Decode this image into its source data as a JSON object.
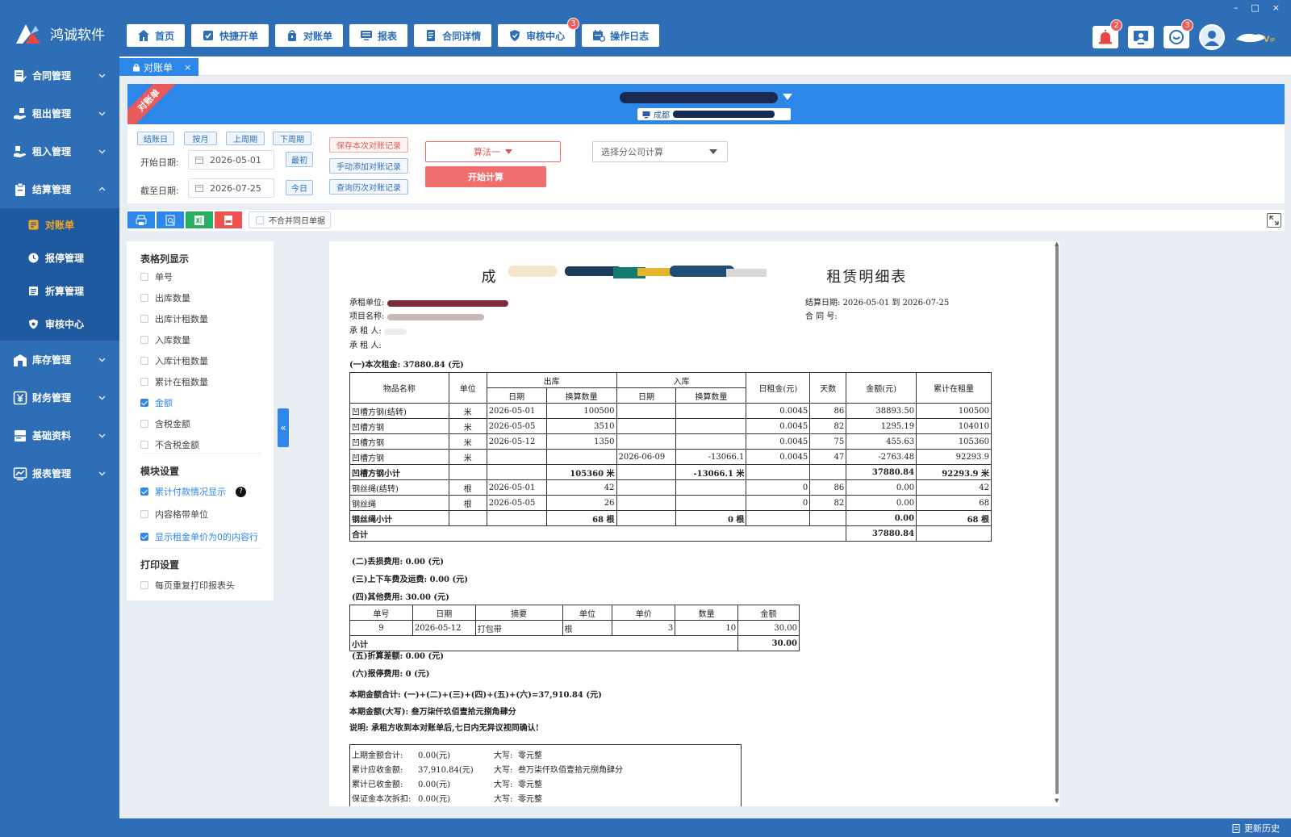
{
  "app": {
    "name": "鸿诚软件",
    "window_controls": [
      "–",
      "□",
      "×"
    ],
    "update_label": "更新历史"
  },
  "nav": [
    {
      "label": "首页",
      "icon": "home-icon"
    },
    {
      "label": "快捷开单",
      "icon": "checkbox-icon"
    },
    {
      "label": "对账单",
      "icon": "bag-icon"
    },
    {
      "label": "报表",
      "icon": "monitor-icon"
    },
    {
      "label": "合同详情",
      "icon": "document-icon"
    },
    {
      "label": "审核中心",
      "icon": "shield-icon",
      "badge": "3"
    },
    {
      "label": "操作日志",
      "icon": "calendar-icon"
    }
  ],
  "header_icons": {
    "alarm_badge": "2",
    "chat_badge": "3"
  },
  "sidebar": {
    "items": [
      {
        "label": "合同管理"
      },
      {
        "label": "租出管理"
      },
      {
        "label": "租入管理"
      },
      {
        "label": "结算管理"
      },
      {
        "label": "库存管理"
      },
      {
        "label": "财务管理"
      },
      {
        "label": "基础资料"
      },
      {
        "label": "报表管理"
      }
    ],
    "sub": [
      {
        "label": "对账单"
      },
      {
        "label": "报停管理"
      },
      {
        "label": "折算管理"
      },
      {
        "label": "审核中心"
      }
    ]
  },
  "tab": {
    "label": "对账单",
    "close": "×"
  },
  "banner": {
    "ribbon": "对账单",
    "sub_prefix": "成都"
  },
  "controls": {
    "quick": [
      "结账日",
      "按月",
      "上周期",
      "下周期"
    ],
    "start_label": "开始日期:",
    "start_date": "2026-05-01",
    "start_btn": "最初",
    "end_label": "截至日期:",
    "end_date": "2026-07-25",
    "end_btn": "今日",
    "save_btn": "保存本次对账记录",
    "add_btn": "手动添加对账记录",
    "query_btn": "查询历次对账记录",
    "algo": "算法一",
    "start_calc": "开始计算",
    "company_placeholder": "选择分公司计算"
  },
  "toolbar": {
    "merge_label": "不合并同日单据",
    "colors": {
      "blue": "#2d87e8",
      "green": "#27ae60",
      "red": "#ef5350"
    }
  },
  "panel": {
    "col_title": "表格列显示",
    "cols": [
      {
        "label": "单号",
        "checked": false
      },
      {
        "label": "出库数量",
        "checked": false
      },
      {
        "label": "出库计租数量",
        "checked": false
      },
      {
        "label": "入库数量",
        "checked": false
      },
      {
        "label": "入库计租数量",
        "checked": false
      },
      {
        "label": "累计在租数量",
        "checked": false
      },
      {
        "label": "金额",
        "checked": true
      },
      {
        "label": "含税金额",
        "checked": false
      },
      {
        "label": "不含税金额",
        "checked": false
      }
    ],
    "module_title": "模块设置",
    "modules": [
      {
        "label": "累计付款情况显示",
        "checked": true
      },
      {
        "label": "内容格带单位",
        "checked": false
      },
      {
        "label": "显示租金单价为0的内容行",
        "checked": true
      }
    ],
    "help": "?",
    "print_title": "打印设置",
    "print": [
      {
        "label": "每页重复打印报表头",
        "checked": false
      }
    ],
    "collapse": "«"
  },
  "report": {
    "title_start": "成",
    "title_end": "租赁明细表",
    "tenant_label": "承租单位:",
    "project_label": "项目名称:",
    "lessee1_label": "承 租 人:",
    "lessee2_label": "承 租 人:",
    "period_label": "结算日期: 2026-05-01 到 2026-07-25",
    "contract_label": "合 同 号:",
    "sec1": "(一)本次租金: 37880.84 (元)",
    "table": {
      "h_item": "物品名称",
      "h_unit": "单位",
      "h_out": "出库",
      "h_in": "入库",
      "h_rent": "日租金(元)",
      "h_days": "天数",
      "h_amount": "金额(元)",
      "h_cum": "累计在租量",
      "h_date": "日期",
      "h_qty": "换算数量",
      "rows": [
        [
          "凹槽方钢(结转)",
          "米",
          "2026-05-01",
          "100500",
          "",
          "",
          "0.0045",
          "86",
          "38893.50",
          "100500"
        ],
        [
          "凹槽方钢",
          "米",
          "2026-05-05",
          "3510",
          "",
          "",
          "0.0045",
          "82",
          "1295.19",
          "104010"
        ],
        [
          "凹槽方钢",
          "米",
          "2026-05-12",
          "1350",
          "",
          "",
          "0.0045",
          "75",
          "455.63",
          "105360"
        ],
        [
          "凹槽方钢",
          "米",
          "",
          "",
          "2026-06-09",
          "-13066.1",
          "0.0045",
          "47",
          "-2763.48",
          "92293.9"
        ],
        [
          "凹槽方钢小计",
          "",
          "",
          "105360 米",
          "",
          "-13066.1 米",
          "",
          "",
          "37880.84",
          "92293.9 米"
        ],
        [
          "钢丝绳(结转)",
          "根",
          "2026-05-01",
          "42",
          "",
          "",
          "0",
          "86",
          "0.00",
          "42"
        ],
        [
          "钢丝绳",
          "根",
          "2026-05-05",
          "26",
          "",
          "",
          "0",
          "82",
          "0.00",
          "68"
        ],
        [
          "钢丝绳小计",
          "",
          "",
          "68 根",
          "",
          "0 根",
          "",
          "",
          "0.00",
          "68 根"
        ]
      ],
      "total_label": "合计",
      "total_amount": "37880.84"
    },
    "sec2": "(二)丢损费用: 0.00 (元)",
    "sec3": "(三)上下车费及运费: 0.00 (元)",
    "sec4": "(四)其他费用: 30.00 (元)",
    "other": {
      "headers": [
        "单号",
        "日期",
        "摘要",
        "单位",
        "单价",
        "数量",
        "金额"
      ],
      "row": [
        "9",
        "2026-05-12",
        "打包带",
        "根",
        "3",
        "10",
        "30.00"
      ],
      "subtotal_label": "小计",
      "subtotal": "30.00"
    },
    "sec5": "(五)折算差额: 0.00 (元)",
    "sec6": "(六)报停费用: 0 (元)",
    "total_line": "本期金额合计: (一)+(二)+(三)+(四)+(五)+(六)=37,910.84 (元)",
    "capital_line": "本期金额(大写): 叁万柒仟玖佰壹拾元捌角肆分",
    "note": "说明: 承租方收到本对账单后,七日内无异议视同确认!",
    "summary": [
      [
        "上期金额合计:",
        "0.00(元)",
        "大写:",
        "零元整"
      ],
      [
        "累计应收金额:",
        "37,910.84(元)",
        "大写:",
        "叁万柒仟玖佰壹拾元捌角肆分"
      ],
      [
        "累计已收金额:",
        "0.00(元)",
        "大写:",
        "零元整"
      ],
      [
        "保证金本次拆扣:",
        "0.00(元)",
        "大写:",
        "零元整"
      ]
    ]
  }
}
